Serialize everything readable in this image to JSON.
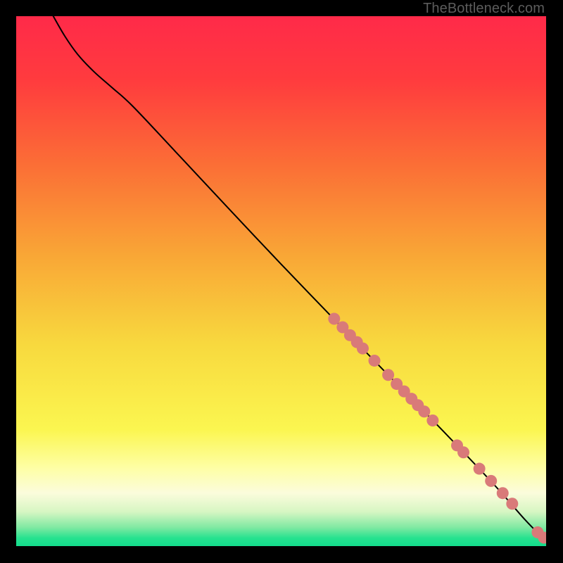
{
  "watermark": "TheBottleneck.com",
  "chart_data": {
    "type": "line",
    "title": "",
    "xlabel": "",
    "ylabel": "",
    "xlim": [
      0,
      100
    ],
    "ylim": [
      0,
      100
    ],
    "background_gradient": {
      "stops": [
        {
          "offset": 0.0,
          "color": "#ff2a49"
        },
        {
          "offset": 0.12,
          "color": "#ff3b3e"
        },
        {
          "offset": 0.28,
          "color": "#fb6e36"
        },
        {
          "offset": 0.45,
          "color": "#f9a636"
        },
        {
          "offset": 0.62,
          "color": "#f8d93e"
        },
        {
          "offset": 0.78,
          "color": "#fbf650"
        },
        {
          "offset": 0.85,
          "color": "#fefea2"
        },
        {
          "offset": 0.9,
          "color": "#fbfcdc"
        },
        {
          "offset": 0.935,
          "color": "#d7f6c3"
        },
        {
          "offset": 0.965,
          "color": "#7fe9a2"
        },
        {
          "offset": 0.985,
          "color": "#26e28f"
        },
        {
          "offset": 1.0,
          "color": "#13dd8c"
        }
      ]
    },
    "curve": [
      {
        "x": 7.0,
        "y": 100.0
      },
      {
        "x": 9.2,
        "y": 96.2
      },
      {
        "x": 11.6,
        "y": 92.8
      },
      {
        "x": 14.6,
        "y": 89.6
      },
      {
        "x": 18.0,
        "y": 86.6
      },
      {
        "x": 22.0,
        "y": 83.0
      },
      {
        "x": 30.0,
        "y": 74.5
      },
      {
        "x": 40.0,
        "y": 63.8
      },
      {
        "x": 50.0,
        "y": 53.2
      },
      {
        "x": 60.0,
        "y": 42.8
      },
      {
        "x": 70.0,
        "y": 32.5
      },
      {
        "x": 80.0,
        "y": 22.3
      },
      {
        "x": 90.0,
        "y": 11.8
      },
      {
        "x": 96.0,
        "y": 5.0
      },
      {
        "x": 99.0,
        "y": 2.0
      },
      {
        "x": 100.0,
        "y": 1.5
      }
    ],
    "series": [
      {
        "name": "markers",
        "color": "#d97a79",
        "points": [
          {
            "x": 60.0,
            "y": 42.9
          },
          {
            "x": 61.6,
            "y": 41.3
          },
          {
            "x": 63.0,
            "y": 39.8
          },
          {
            "x": 64.3,
            "y": 38.5
          },
          {
            "x": 65.4,
            "y": 37.3
          },
          {
            "x": 67.6,
            "y": 35.0
          },
          {
            "x": 70.2,
            "y": 32.3
          },
          {
            "x": 71.8,
            "y": 30.6
          },
          {
            "x": 73.2,
            "y": 29.2
          },
          {
            "x": 74.6,
            "y": 27.8
          },
          {
            "x": 75.8,
            "y": 26.6
          },
          {
            "x": 77.0,
            "y": 25.4
          },
          {
            "x": 78.6,
            "y": 23.7
          },
          {
            "x": 83.2,
            "y": 19.0
          },
          {
            "x": 84.4,
            "y": 17.7
          },
          {
            "x": 87.4,
            "y": 14.6
          },
          {
            "x": 89.6,
            "y": 12.3
          },
          {
            "x": 91.8,
            "y": 10.0
          },
          {
            "x": 93.6,
            "y": 8.0
          },
          {
            "x": 98.4,
            "y": 2.6
          },
          {
            "x": 99.6,
            "y": 1.6
          }
        ]
      }
    ]
  }
}
